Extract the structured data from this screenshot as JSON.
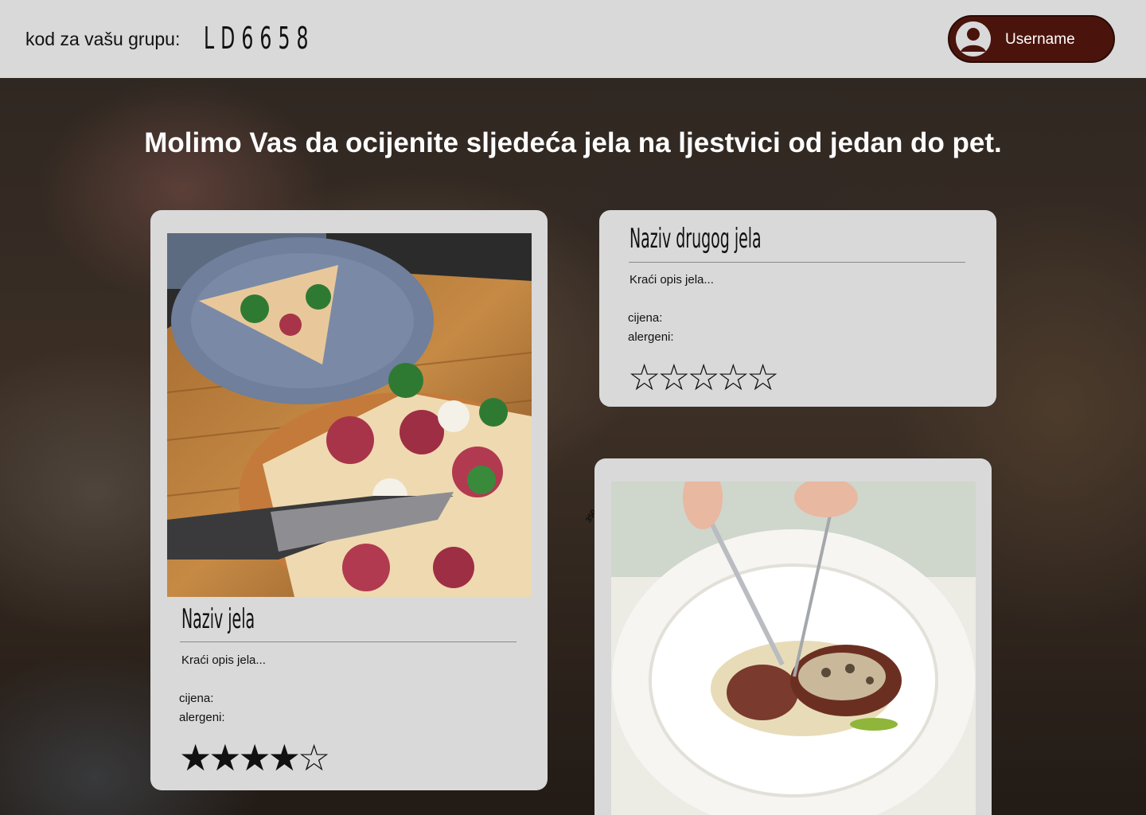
{
  "header": {
    "code_label": "kod za vašu grupu:",
    "group_code": "LD6658",
    "username": "Username"
  },
  "main": {
    "instruction": "Molimo Vas da ocijenite sljedeća jela na ljestvici od jedan do pet."
  },
  "dishes": [
    {
      "title": "Naziv jela",
      "description": "Kraći opis jela...",
      "price_label": "cijena:",
      "allergens_label": "alergeni:",
      "rating": 4,
      "max_rating": 5,
      "image": "pizza-prosciutto"
    },
    {
      "title": "Naziv drugog jela",
      "description": "Kraći opis jela...",
      "price_label": "cijena:",
      "allergens_label": "alergeni:",
      "rating": 0,
      "max_rating": 5
    },
    {
      "image": "steak-with-mushroom-sauce"
    }
  ],
  "colors": {
    "header_bg": "#d9d9d9",
    "user_button": "#4a140c",
    "card_bg": "#d9d9d9",
    "star": "#111111"
  },
  "icons": {
    "avatar": "user-circle-icon",
    "star_filled": "★",
    "star_empty": "☆"
  }
}
